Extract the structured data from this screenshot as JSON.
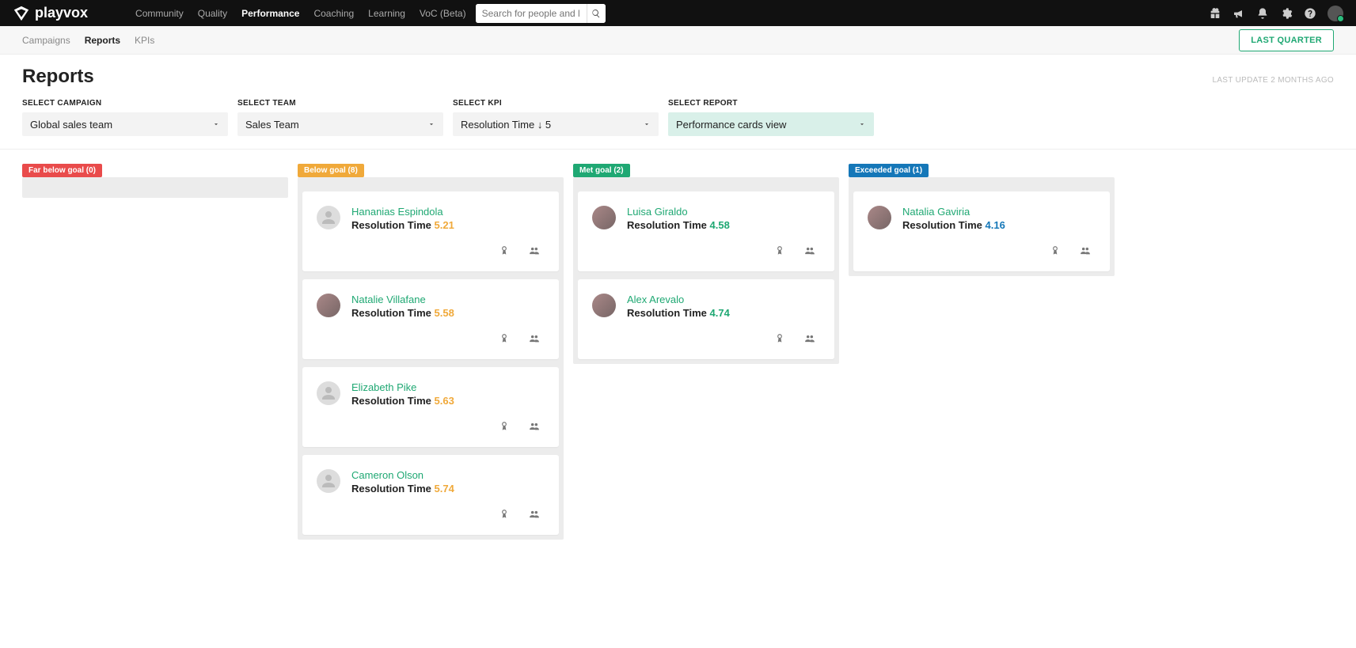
{
  "brand": "playvox",
  "topnav": {
    "items": [
      "Community",
      "Quality",
      "Performance",
      "Coaching",
      "Learning",
      "VoC (Beta)"
    ],
    "active": "Performance",
    "search_placeholder": "Search for people and l"
  },
  "subnav": {
    "items": [
      "Campaigns",
      "Reports",
      "KPIs"
    ],
    "active": "Reports",
    "period_button": "LAST QUARTER"
  },
  "page": {
    "title": "Reports",
    "last_update": "LAST UPDATE 2 MONTHS AGO"
  },
  "filters": {
    "campaign": {
      "label": "SELECT CAMPAIGN",
      "value": "Global sales team"
    },
    "team": {
      "label": "SELECT TEAM",
      "value": "Sales Team"
    },
    "kpi": {
      "label": "SELECT KPI",
      "value": "Resolution Time ↓ 5"
    },
    "report": {
      "label": "SELECT REPORT",
      "value": "Performance cards view"
    }
  },
  "colors": {
    "far_below": "#e94b4b",
    "below": "#f0a93a",
    "met": "#1fa873",
    "exceeded": "#1577b8"
  },
  "columns": [
    {
      "key": "far_below",
      "label": "Far below goal (0)",
      "value_color": "#e94b4b",
      "cards": []
    },
    {
      "key": "below",
      "label": "Below goal (8)",
      "value_color": "#f0a93a",
      "cards": [
        {
          "name": "Hananias Espindola",
          "metric_label": "Resolution Time",
          "value": "5.21",
          "photo": false
        },
        {
          "name": "Natalie Villafane",
          "metric_label": "Resolution Time",
          "value": "5.58",
          "photo": true
        },
        {
          "name": "Elizabeth Pike",
          "metric_label": "Resolution Time",
          "value": "5.63",
          "photo": false
        },
        {
          "name": "Cameron Olson",
          "metric_label": "Resolution Time",
          "value": "5.74",
          "photo": false
        }
      ]
    },
    {
      "key": "met",
      "label": "Met goal (2)",
      "value_color": "#1fa873",
      "cards": [
        {
          "name": "Luisa Giraldo",
          "metric_label": "Resolution Time",
          "value": "4.58",
          "photo": true
        },
        {
          "name": "Alex Arevalo",
          "metric_label": "Resolution Time",
          "value": "4.74",
          "photo": true
        }
      ]
    },
    {
      "key": "exceeded",
      "label": "Exceeded goal (1)",
      "value_color": "#1577b8",
      "cards": [
        {
          "name": "Natalia Gaviria",
          "metric_label": "Resolution Time",
          "value": "4.16",
          "photo": true
        }
      ]
    }
  ]
}
